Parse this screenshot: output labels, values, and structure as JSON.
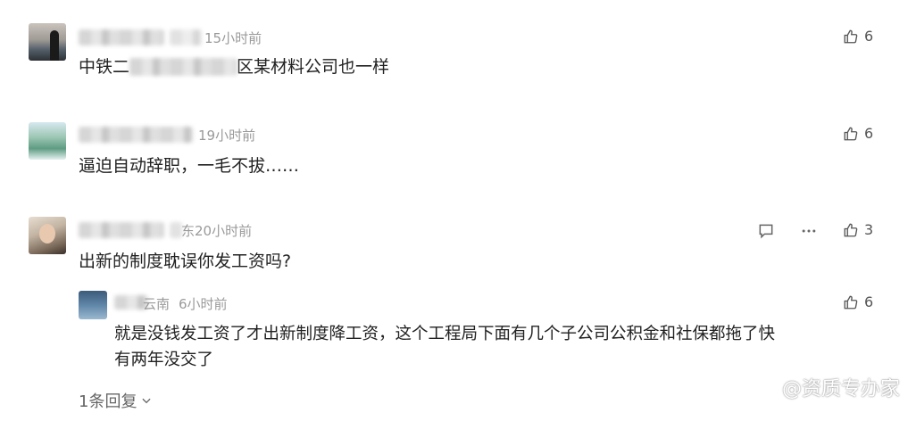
{
  "comments": [
    {
      "time": "15小时前",
      "content_pre": "中铁二",
      "content_post": "区某材料公司也一样",
      "likes": "6"
    },
    {
      "time": "19小时前",
      "content": "逼迫自动辞职，一毛不拔……",
      "likes": "6"
    },
    {
      "location_tail": "东",
      "time": "20小时前",
      "content": "出新的制度耽误你发工资吗?",
      "likes": "3",
      "reply": {
        "location": "云南",
        "time": "6小时前",
        "line1": "就是没钱发工资了才出新制度降工资，这个工程局下面有几个子公司公积金和社保都拖了快",
        "line2": "有两年没交了",
        "likes": "6"
      },
      "reply_count_label": "1条回复"
    }
  ],
  "watermark": "@资质专办家",
  "icons": {
    "like": "thumbs-up-icon",
    "comment": "comment-bubble-icon",
    "more": "more-dots-icon",
    "expand": "chevron-down-icon",
    "watermark_logo": "logo-icon"
  },
  "colors": {
    "meta": "#9a9a9a",
    "text": "#222222",
    "icon": "#555555"
  }
}
